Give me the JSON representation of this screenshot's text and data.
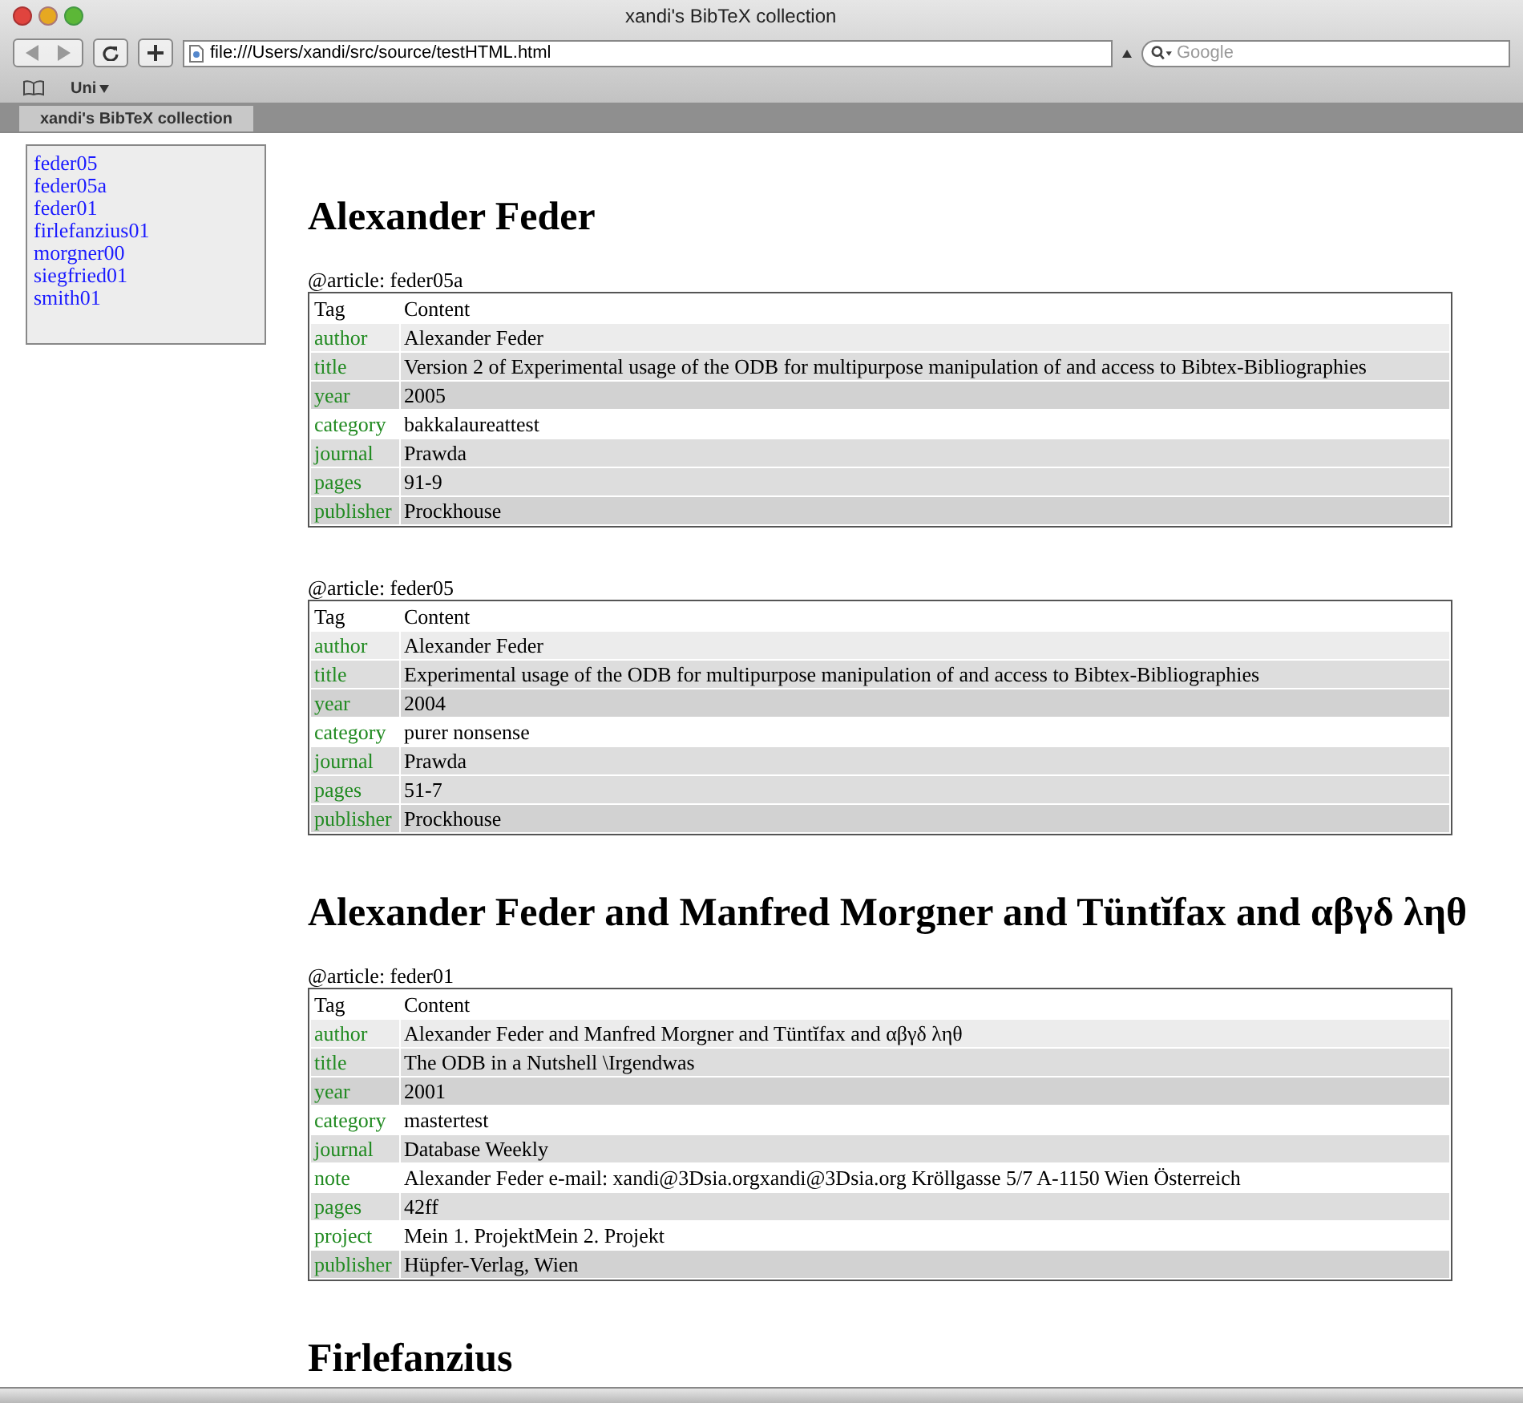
{
  "window": {
    "title": "xandi's BibTeX collection"
  },
  "toolbar": {
    "url": "file:///Users/xandi/src/source/testHTML.html",
    "search": {
      "placeholder": "Google"
    }
  },
  "bookmarks": [
    {
      "label": "Uni"
    }
  ],
  "tabs": [
    {
      "label": "xandi's BibTeX collection",
      "selected": true
    }
  ],
  "sidebar": {
    "items": [
      "feder05",
      "feder05a",
      "feder01",
      "firlefanzius01",
      "morgner00",
      "siegfried01",
      "smith01"
    ]
  },
  "sections": [
    {
      "heading": "Alexander Feder",
      "entries": [
        {
          "caption": "@article: feder05a",
          "columns": [
            "Tag",
            "Content"
          ],
          "rows": [
            {
              "tag": "author",
              "content": "Alexander Feder",
              "kind": "light"
            },
            {
              "tag": "title",
              "content": "Version 2 of Experimental usage of the ODB for multipurpose manipulation of and access to Bibtex-Bibliographies",
              "kind": "mid"
            },
            {
              "tag": "year",
              "content": "2005",
              "kind": "dark"
            },
            {
              "tag": "category",
              "content": "bakkalaureattest",
              "kind": "plain"
            },
            {
              "tag": "journal",
              "content": "Prawda",
              "kind": "mid"
            },
            {
              "tag": "pages",
              "content": "91-9",
              "kind": "mid"
            },
            {
              "tag": "publisher",
              "content": "Prockhouse",
              "kind": "dark"
            }
          ]
        },
        {
          "caption": "@article: feder05",
          "columns": [
            "Tag",
            "Content"
          ],
          "rows": [
            {
              "tag": "author",
              "content": "Alexander Feder",
              "kind": "light"
            },
            {
              "tag": "title",
              "content": "Experimental usage of the ODB for multipurpose manipulation of and access to Bibtex-Bibliographies",
              "kind": "mid"
            },
            {
              "tag": "year",
              "content": "2004",
              "kind": "dark"
            },
            {
              "tag": "category",
              "content": "purer nonsense",
              "kind": "plain"
            },
            {
              "tag": "journal",
              "content": "Prawda",
              "kind": "mid"
            },
            {
              "tag": "pages",
              "content": "51-7",
              "kind": "mid"
            },
            {
              "tag": "publisher",
              "content": "Prockhouse",
              "kind": "dark"
            }
          ]
        }
      ]
    },
    {
      "heading": "Alexander Feder and Manfred Morgner and Tüntĭfax and αβγδ ληθ",
      "entries": [
        {
          "caption": "@article: feder01",
          "columns": [
            "Tag",
            "Content"
          ],
          "rows": [
            {
              "tag": "author",
              "content": "Alexander Feder and Manfred Morgner and Tüntĭfax and αβγδ ληθ",
              "kind": "light"
            },
            {
              "tag": "title",
              "content": "The ODB in a Nutshell \\Irgendwas",
              "kind": "mid"
            },
            {
              "tag": "year",
              "content": "2001",
              "kind": "dark"
            },
            {
              "tag": "category",
              "content": "mastertest",
              "kind": "plain"
            },
            {
              "tag": "journal",
              "content": "Database Weekly",
              "kind": "mid"
            },
            {
              "tag": "note",
              "content": "Alexander Feder e-mail: xandi@3Dsia.orgxandi@3Dsia.org Kröllgasse 5/7 A-1150 Wien Österreich",
              "kind": "plain"
            },
            {
              "tag": "pages",
              "content": "42ff",
              "kind": "mid"
            },
            {
              "tag": "project",
              "content": "Mein 1. ProjektMein 2. Projekt",
              "kind": "plain"
            },
            {
              "tag": "publisher",
              "content": "Hüpfer-Verlag, Wien",
              "kind": "dark"
            }
          ]
        }
      ]
    },
    {
      "heading": "Firlefanzius"
    }
  ]
}
